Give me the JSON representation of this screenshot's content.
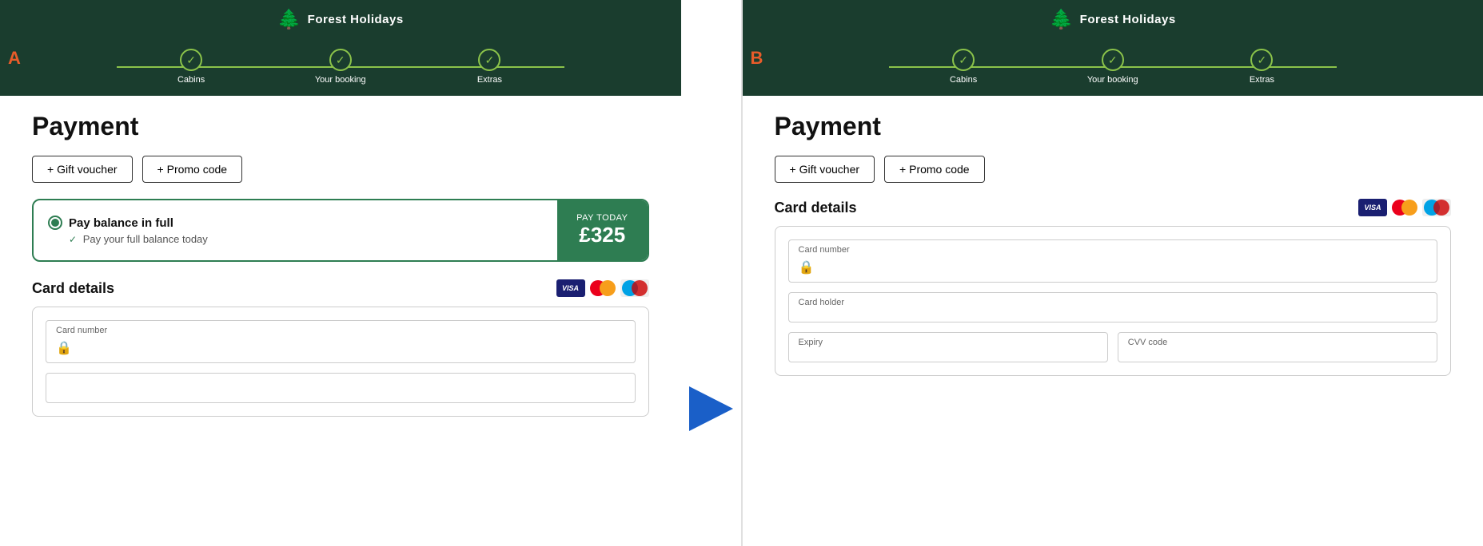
{
  "panelA": {
    "label": "A",
    "header": {
      "logo_icon": "🌲",
      "logo_text": "Forest Holidays"
    },
    "progress": {
      "steps": [
        {
          "label": "Cabins",
          "completed": true
        },
        {
          "label": "Your booking",
          "completed": true
        },
        {
          "label": "Extras",
          "completed": true
        }
      ]
    },
    "payment": {
      "title": "Payment",
      "gift_voucher_label": "+ Gift voucher",
      "promo_code_label": "+ Promo code",
      "pay_option": {
        "title": "Pay balance in full",
        "subtitle": "Pay your full balance today",
        "pay_today_label": "PAY TODAY",
        "amount": "£325"
      },
      "card_details": {
        "title": "Card details",
        "card_number_label": "Card number",
        "card_number_placeholder": "",
        "lock_icon": "🔒"
      }
    }
  },
  "panelB": {
    "label": "B",
    "header": {
      "logo_icon": "🌲",
      "logo_text": "Forest Holidays"
    },
    "progress": {
      "steps": [
        {
          "label": "Cabins",
          "completed": true
        },
        {
          "label": "Your booking",
          "completed": true
        },
        {
          "label": "Extras",
          "completed": true
        }
      ]
    },
    "payment": {
      "title": "Payment",
      "gift_voucher_label": "+ Gift voucher",
      "promo_code_label": "+ Promo code",
      "card_details": {
        "title": "Card details",
        "card_number_label": "Card number",
        "card_holder_label": "Card holder",
        "expiry_label": "Expiry",
        "cvv_label": "CVV code",
        "lock_icon": "🔒"
      }
    }
  }
}
